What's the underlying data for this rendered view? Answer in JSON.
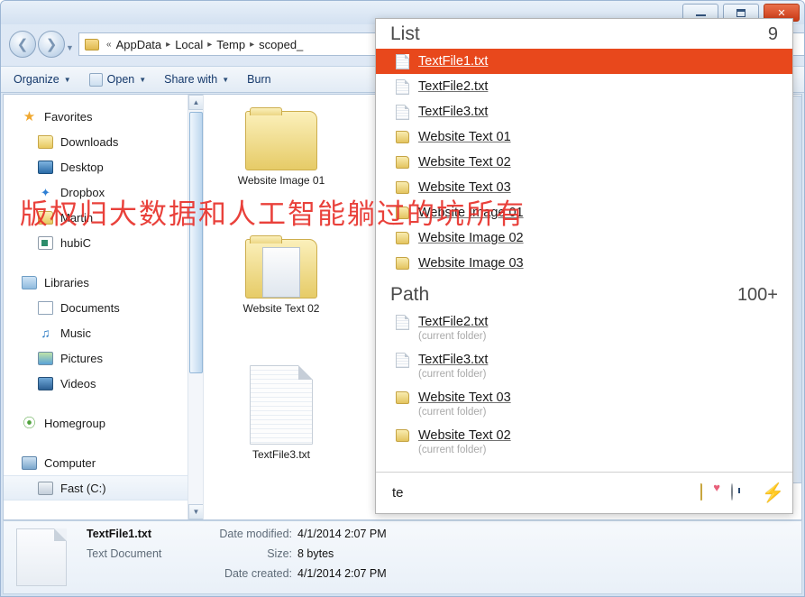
{
  "window": {
    "buttons": {
      "minimize": "minimize-button",
      "maximize": "maximize-button",
      "close": "close-button"
    }
  },
  "address": {
    "overflow": "«",
    "segments": [
      "AppData",
      "Local",
      "Temp",
      "scoped_"
    ],
    "separator": "▸"
  },
  "commandbar": {
    "items": [
      {
        "label": "Organize",
        "caret": "▼",
        "icon": ""
      },
      {
        "label": "Open",
        "caret": "▼",
        "icon": "notepad-icon"
      },
      {
        "label": "Share with",
        "caret": "▼",
        "icon": ""
      },
      {
        "label": "Burn",
        "caret": "",
        "icon": ""
      }
    ]
  },
  "sidebar": {
    "items": [
      {
        "label": "Favorites",
        "icon": "star",
        "level": 0
      },
      {
        "label": "Downloads",
        "icon": "folder",
        "level": 1
      },
      {
        "label": "Desktop",
        "icon": "desktop",
        "level": 1
      },
      {
        "label": "Dropbox",
        "icon": "dropbox",
        "level": 1
      },
      {
        "label": "Martin",
        "icon": "folder",
        "level": 1
      },
      {
        "label": "hubiC",
        "icon": "hubic",
        "level": 1
      },
      {
        "label": "Libraries",
        "icon": "lib",
        "level": 0
      },
      {
        "label": "Documents",
        "icon": "doc",
        "level": 1
      },
      {
        "label": "Music",
        "icon": "music",
        "level": 1
      },
      {
        "label": "Pictures",
        "icon": "pic",
        "level": 1
      },
      {
        "label": "Videos",
        "icon": "vid",
        "level": 1
      },
      {
        "label": "Homegroup",
        "icon": "home",
        "level": 0
      },
      {
        "label": "Computer",
        "icon": "computer",
        "level": 0
      },
      {
        "label": "Fast (C:)",
        "icon": "drive",
        "level": 1
      }
    ]
  },
  "files": [
    {
      "label": "Website Image 01",
      "type": "folder"
    },
    {
      "label": "Website Text 02",
      "type": "folder-stack"
    },
    {
      "label": "TextFile3.txt",
      "type": "file"
    }
  ],
  "details": {
    "name": "TextFile1.txt",
    "type": "Text Document",
    "rows": [
      {
        "label": "Date modified:",
        "value": "4/1/2014 2:07 PM"
      },
      {
        "label": "Size:",
        "value": "8 bytes"
      },
      {
        "label": "Date created:",
        "value": "4/1/2014 2:07 PM"
      }
    ]
  },
  "popup": {
    "list": {
      "title": "List",
      "count": "9",
      "items": [
        {
          "label": "TextFile1.txt",
          "icon": "file",
          "selected": true
        },
        {
          "label": "TextFile2.txt",
          "icon": "file",
          "selected": false
        },
        {
          "label": "TextFile3.txt",
          "icon": "file",
          "selected": false
        },
        {
          "label": "Website Text 01",
          "icon": "folder",
          "selected": false
        },
        {
          "label": "Website Text 02",
          "icon": "folder",
          "selected": false
        },
        {
          "label": "Website Text 03",
          "icon": "folder",
          "selected": false
        },
        {
          "label": "Website Image 01",
          "icon": "folder",
          "selected": false
        },
        {
          "label": "Website Image 02",
          "icon": "folder",
          "selected": false
        },
        {
          "label": "Website Image 03",
          "icon": "folder",
          "selected": false
        }
      ]
    },
    "path": {
      "title": "Path",
      "count": "100+",
      "items": [
        {
          "label": "TextFile2.txt",
          "icon": "file",
          "sub": "(current folder)"
        },
        {
          "label": "TextFile3.txt",
          "icon": "file",
          "sub": "(current folder)"
        },
        {
          "label": "Website Text 03",
          "icon": "folder",
          "sub": "(current folder)"
        },
        {
          "label": "Website Text 02",
          "icon": "folder",
          "sub": "(current folder)"
        }
      ]
    },
    "footer": {
      "query": "te",
      "icons": [
        "favorites-folder-icon",
        "history-clock-icon",
        "lightning-bolt-icon"
      ]
    }
  },
  "watermark": {
    "text": "版权归大数据和人工智能躺过的坑所有"
  },
  "colors": {
    "selection": "#E8481C",
    "accent_blue": "#2a6ca8",
    "close_red": "#cf3b16"
  }
}
